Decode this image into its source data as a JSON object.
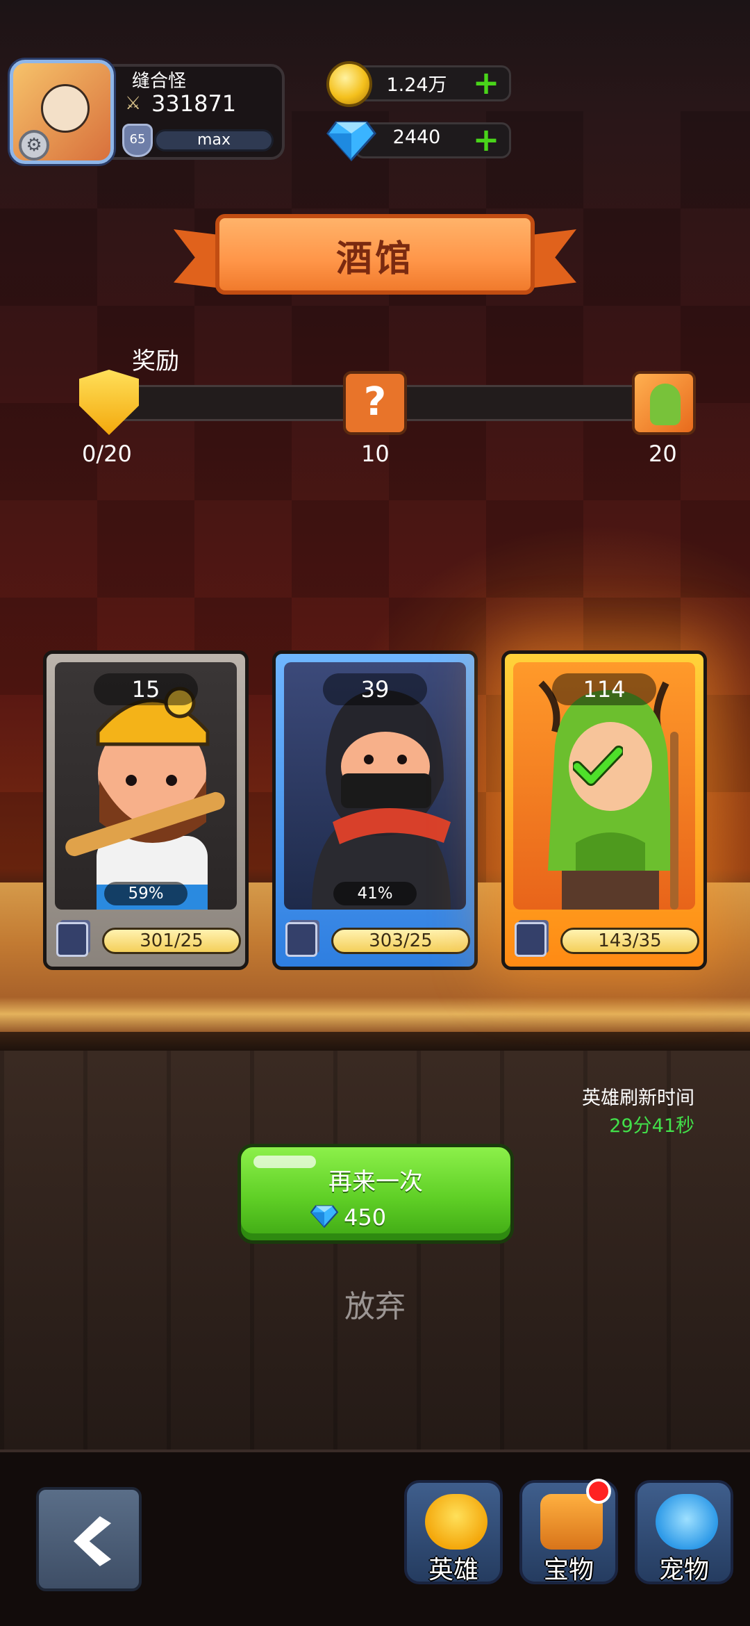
{
  "player": {
    "name": "缝合怪",
    "power": "331871",
    "level": "65",
    "xp_text": "max"
  },
  "currency": {
    "gold": "1.24万",
    "gems": "2440",
    "gold_icon": "gold-coin-icon",
    "gem_icon": "diamond-icon"
  },
  "banner": {
    "title": "酒馆"
  },
  "reward": {
    "label": "奖励",
    "progress_text": "0/20",
    "progress_value": 0,
    "milestones": [
      "10",
      "20"
    ]
  },
  "cards": [
    {
      "count": "15",
      "percent": "59%",
      "fragments": "301/25",
      "rarity": "gray",
      "hero": "miner"
    },
    {
      "count": "39",
      "percent": "41%",
      "fragments": "303/25",
      "rarity": "blue",
      "hero": "ninja"
    },
    {
      "count": "114",
      "percent": "",
      "fragments": "143/35",
      "rarity": "gold",
      "hero": "elf",
      "selected": true
    }
  ],
  "refresh": {
    "label": "英雄刷新时间",
    "time": "29分41秒"
  },
  "retry": {
    "label": "再来一次",
    "cost": "450"
  },
  "give_up": "放弃",
  "nav": {
    "heroes": "英雄",
    "treasure": "宝物",
    "pets": "宠物"
  },
  "colors": {
    "accent_green": "#5fcf26",
    "timer_green": "#42e04a",
    "banner_orange": "#ff9548"
  }
}
